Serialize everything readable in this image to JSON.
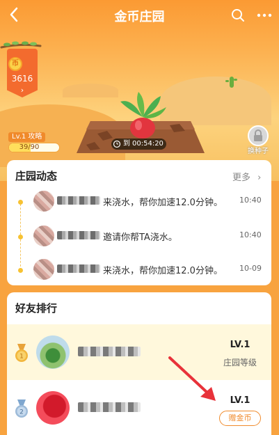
{
  "header": {
    "title": "金币庄园",
    "back_icon": "chevron-left-icon",
    "search_icon": "search-icon",
    "more_icon": "ellipsis-icon"
  },
  "coins": {
    "icon_label": "币",
    "count": "3616",
    "arrow": "›"
  },
  "level": {
    "label": "Lv.1 攻略",
    "progress": "39/90",
    "progress_fraction": 0.433
  },
  "plant": {
    "countdown_prefix": "到",
    "countdown": "00:54:20"
  },
  "seed": {
    "label": "换种子"
  },
  "news": {
    "title": "庄园动态",
    "more": "更多",
    "items": [
      {
        "text": "来浇水，帮你加速12.0分钟。",
        "time": "10:40"
      },
      {
        "text": "邀请你帮TA浇水。",
        "time": "10:40"
      },
      {
        "text": "来浇水，帮你加速12.0分钟。",
        "time": "10-09"
      }
    ]
  },
  "ranking": {
    "title": "好友排行",
    "rows": [
      {
        "rank": "1",
        "level": "LV.1",
        "sub": "庄园等级"
      },
      {
        "rank": "2",
        "level": "LV.1",
        "button": "赠金币"
      }
    ]
  },
  "colors": {
    "accent": "#F08A2B",
    "gold": "#F7C232"
  }
}
